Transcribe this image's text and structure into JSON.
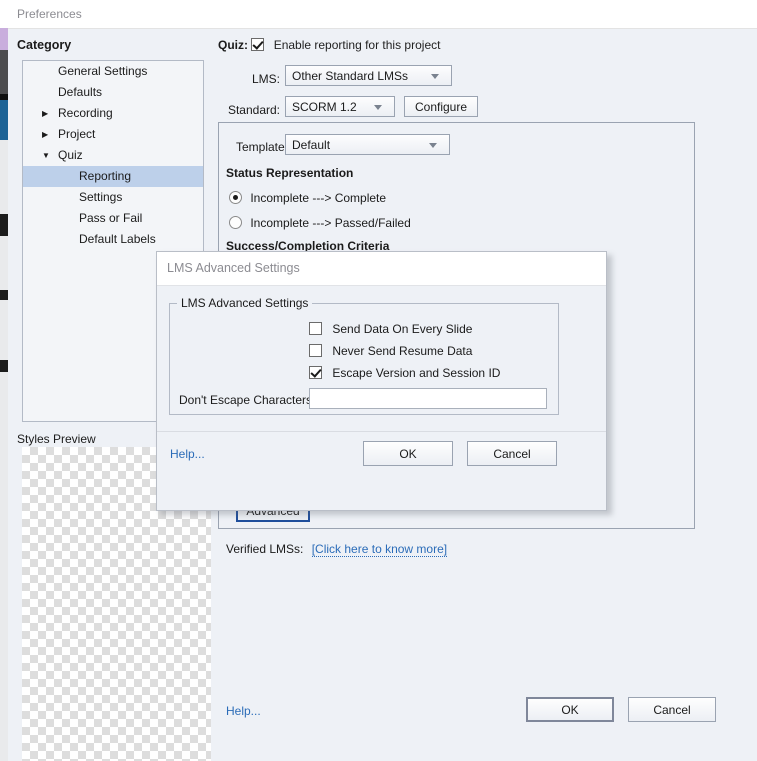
{
  "window": {
    "title": "Preferences"
  },
  "sidebar": {
    "heading": "Category",
    "items": [
      {
        "label": "General Settings",
        "arrow": "",
        "level": 0,
        "selected": false
      },
      {
        "label": "Defaults",
        "arrow": "",
        "level": 0,
        "selected": false
      },
      {
        "label": "Recording",
        "arrow": "collapsed-triangle-icon",
        "level": 0,
        "selected": false
      },
      {
        "label": "Project",
        "arrow": "collapsed-triangle-icon",
        "level": 0,
        "selected": false
      },
      {
        "label": "Quiz",
        "arrow": "expanded-triangle-icon",
        "level": 0,
        "selected": false
      },
      {
        "label": "Reporting",
        "arrow": "",
        "level": 1,
        "selected": true
      },
      {
        "label": "Settings",
        "arrow": "",
        "level": 1,
        "selected": false
      },
      {
        "label": "Pass or Fail",
        "arrow": "",
        "level": 1,
        "selected": false
      },
      {
        "label": "Default Labels",
        "arrow": "",
        "level": 1,
        "selected": false
      }
    ],
    "styles_preview_label": "Styles Preview"
  },
  "main": {
    "quiz_label": "Quiz:",
    "enable_reporting_label": "Enable reporting for this project",
    "enable_reporting_checked": true,
    "lms_label": "LMS:",
    "lms_value": "Other Standard LMSs",
    "standard_label": "Standard:",
    "standard_value": "SCORM 1.2",
    "configure_label": "Configure",
    "template_label": "Template:",
    "template_value": "Default",
    "status_representation_title": "Status Representation",
    "status_options": [
      {
        "label": "Incomplete ---> Complete",
        "selected": true
      },
      {
        "label": "Incomplete ---> Passed/Failed",
        "selected": false
      }
    ],
    "success_criteria_title": "Success/Completion Criteria",
    "advanced_label": "Advanced",
    "verified_lms_label": "Verified LMSs:",
    "verified_lms_link": "[Click here to know more]",
    "help_label": "Help...",
    "ok_label": "OK",
    "cancel_label": "Cancel"
  },
  "modal": {
    "title": "LMS Advanced Settings",
    "group_caption": "LMS Advanced Settings",
    "checkboxes": [
      {
        "label": "Send Data On Every Slide",
        "checked": false
      },
      {
        "label": "Never Send Resume Data",
        "checked": false
      },
      {
        "label": "Escape Version and Session ID",
        "checked": true
      }
    ],
    "dont_escape_label": "Don't Escape Characters:",
    "dont_escape_value": "",
    "dont_escape_placeholder": "",
    "help_label": "Help...",
    "ok_label": "OK",
    "cancel_label": "Cancel"
  },
  "colors": {
    "window_bg": "#eef1f6",
    "selection": "#bdd0ea",
    "link": "#2b6cb8",
    "focus_border": "#1f4e9c",
    "title_text": "#8c8c92"
  }
}
